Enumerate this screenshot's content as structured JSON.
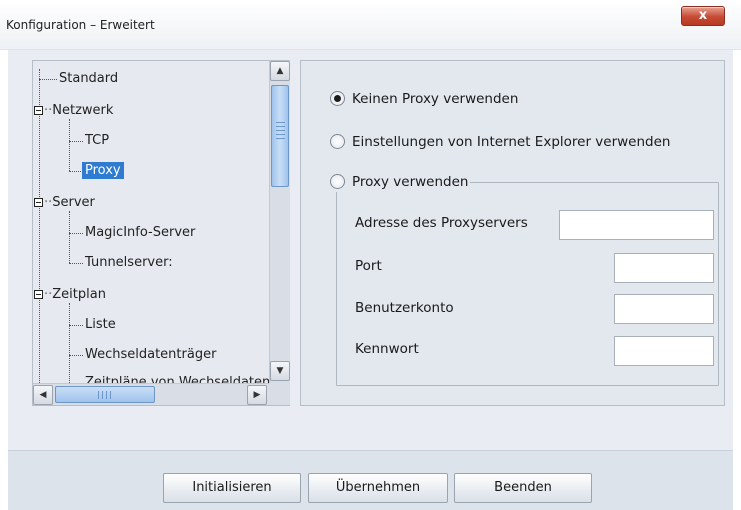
{
  "window": {
    "title": "Konfiguration – Erweitert",
    "close_label": "x"
  },
  "tree": {
    "items": [
      {
        "label": "Standard"
      },
      {
        "label": "Netzwerk"
      },
      {
        "label": "TCP"
      },
      {
        "label": "Proxy",
        "selected": true
      },
      {
        "label": "Server"
      },
      {
        "label": "MagicInfo-Server"
      },
      {
        "label": "Tunnelserver:"
      },
      {
        "label": "Zeitplan"
      },
      {
        "label": "Liste"
      },
      {
        "label": "Wechseldatenträger"
      },
      {
        "label": "Zeitpläne von Wechseldatenträgern"
      }
    ]
  },
  "proxy": {
    "options": [
      {
        "label": "Keinen Proxy verwenden",
        "checked": true
      },
      {
        "label": "Einstellungen von Internet Explorer verwenden",
        "checked": false
      },
      {
        "label": "Proxy verwenden",
        "checked": false
      }
    ],
    "fields": {
      "address_label": "Adresse des Proxyservers",
      "address_value": "",
      "port_label": "Port",
      "port_value": "",
      "user_label": "Benutzerkonto",
      "user_value": "",
      "password_label": "Kennwort",
      "password_value": ""
    }
  },
  "buttons": {
    "initialize": "Initialisieren",
    "apply": "Übernehmen",
    "exit": "Beenden"
  },
  "colors": {
    "selection": "#2e7bd0",
    "close_button": "#c64a34",
    "panel_bg": "#e3e8ef"
  }
}
